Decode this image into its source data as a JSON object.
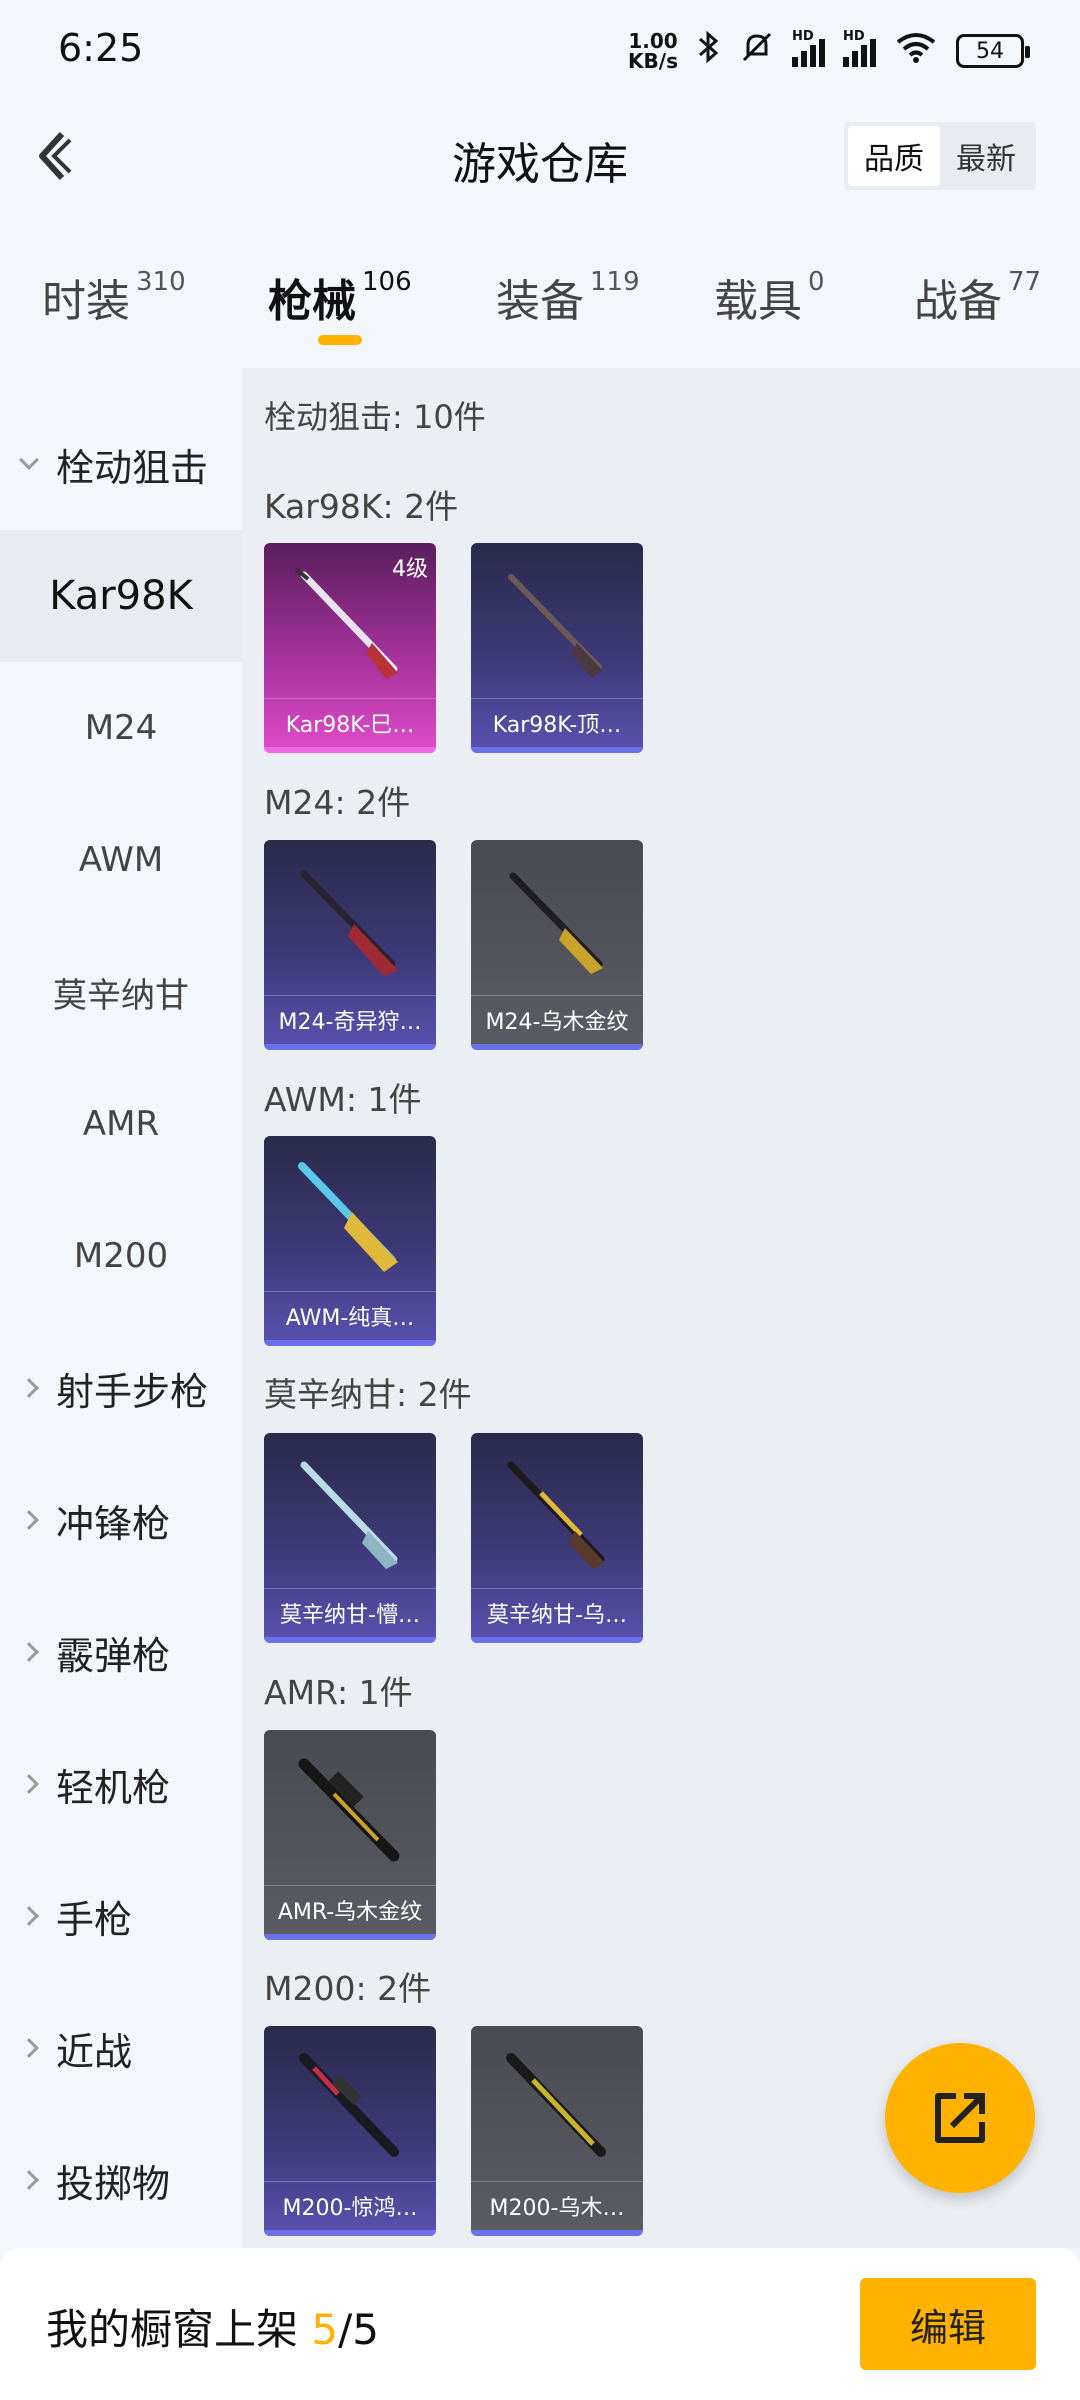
{
  "status_bar": {
    "time": "6:25",
    "net_speed_value": "1.00",
    "net_speed_unit": "KB/s",
    "signal_tag": "HD",
    "battery": "54"
  },
  "header": {
    "title": "游戏仓库",
    "sort_options": [
      "品质",
      "最新"
    ],
    "active_sort": "品质"
  },
  "tabs": [
    {
      "label": "时装",
      "count": "310"
    },
    {
      "label": "枪械",
      "count": "106",
      "active": true
    },
    {
      "label": "装备",
      "count": "119"
    },
    {
      "label": "载具",
      "count": "0"
    },
    {
      "label": "战备",
      "count": "77"
    }
  ],
  "sidebar": {
    "expanded_category": "栓动狙击",
    "sub_items": [
      "Kar98K",
      "M24",
      "AWM",
      "莫辛纳甘",
      "AMR",
      "M200"
    ],
    "active_sub": "Kar98K",
    "categories": [
      "射手步枪",
      "冲锋枪",
      "霰弹枪",
      "轻机枪",
      "手枪",
      "近战",
      "投掷物"
    ]
  },
  "content": {
    "category_title": "栓动狙击: 10件",
    "groups": [
      {
        "label": "Kar98K: 2件",
        "items": [
          {
            "name": "Kar98K-巳…",
            "quality": "pink",
            "level": "4级"
          },
          {
            "name": "Kar98K-顶…",
            "quality": "purple"
          }
        ]
      },
      {
        "label": "M24: 2件",
        "items": [
          {
            "name": "M24-奇异狩…",
            "quality": "purple"
          },
          {
            "name": "M24-乌木金纹",
            "quality": "grey"
          }
        ]
      },
      {
        "label": "AWM: 1件",
        "items": [
          {
            "name": "AWM-纯真…",
            "quality": "purple"
          }
        ]
      },
      {
        "label": "莫辛纳甘: 2件",
        "items": [
          {
            "name": "莫辛纳甘-懵…",
            "quality": "purple"
          },
          {
            "name": "莫辛纳甘-乌…",
            "quality": "purple"
          }
        ]
      },
      {
        "label": "AMR: 1件",
        "items": [
          {
            "name": "AMR-乌木金纹",
            "quality": "grey"
          }
        ]
      },
      {
        "label": "M200: 2件",
        "items": [
          {
            "name": "M200-惊鸿…",
            "quality": "purple"
          },
          {
            "name": "M200-乌木…",
            "quality": "grey"
          }
        ]
      }
    ]
  },
  "bottom": {
    "label": "我的橱窗上架",
    "current": "5",
    "total": "/5",
    "edit_label": "编辑"
  },
  "colors": {
    "accent": "#ffb300",
    "purple_quality": "#5a52b0",
    "pink_quality": "#e04cc9",
    "grey_quality": "#5b5c63"
  }
}
